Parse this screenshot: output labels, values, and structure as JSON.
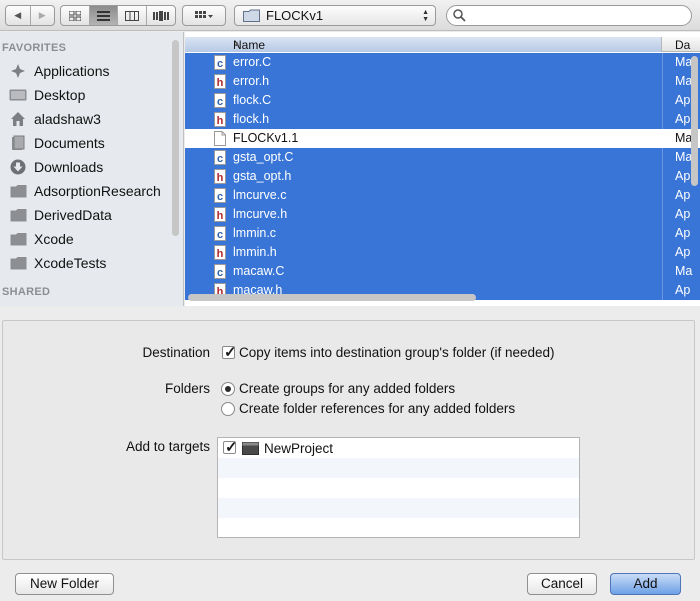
{
  "toolbar": {
    "back_icon": "chevron-left-icon",
    "forward_icon": "chevron-right-icon",
    "view_modes": [
      "icon-view",
      "list-view",
      "column-view",
      "coverflow-view"
    ],
    "active_view": "list-view",
    "arrange_icon": "grid-arrange-icon",
    "location_label": "FLOCKv1",
    "search_placeholder": ""
  },
  "sidebar": {
    "favorites_label": "FAVORITES",
    "items": [
      {
        "label": "Applications",
        "icon": "applications-icon"
      },
      {
        "label": "Desktop",
        "icon": "desktop-icon"
      },
      {
        "label": "aladshaw3",
        "icon": "home-icon"
      },
      {
        "label": "Documents",
        "icon": "documents-icon"
      },
      {
        "label": "Downloads",
        "icon": "downloads-icon"
      },
      {
        "label": "AdsorptionResearch",
        "icon": "folder-icon"
      },
      {
        "label": "DerivedData",
        "icon": "folder-icon"
      },
      {
        "label": "Xcode",
        "icon": "folder-icon"
      },
      {
        "label": "XcodeTests",
        "icon": "folder-icon"
      }
    ],
    "shared_label": "SHARED"
  },
  "filelist": {
    "col_name": "Name",
    "col_date": "Da",
    "files": [
      {
        "name": "error.C",
        "type": "c",
        "date": "Ma",
        "selected": true
      },
      {
        "name": "error.h",
        "type": "h",
        "date": "Ma",
        "selected": true
      },
      {
        "name": "flock.C",
        "type": "c",
        "date": "Ap",
        "selected": true
      },
      {
        "name": "flock.h",
        "type": "h",
        "date": "Ap",
        "selected": true
      },
      {
        "name": "FLOCKv1.1",
        "type": "doc",
        "date": "Ma",
        "selected": false
      },
      {
        "name": "gsta_opt.C",
        "type": "c",
        "date": "Ma",
        "selected": true
      },
      {
        "name": "gsta_opt.h",
        "type": "h",
        "date": "Ap",
        "selected": true
      },
      {
        "name": "lmcurve.c",
        "type": "c",
        "date": "Ap",
        "selected": true
      },
      {
        "name": "lmcurve.h",
        "type": "h",
        "date": "Ap",
        "selected": true
      },
      {
        "name": "lmmin.c",
        "type": "c",
        "date": "Ap",
        "selected": true
      },
      {
        "name": "lmmin.h",
        "type": "h",
        "date": "Ap",
        "selected": true
      },
      {
        "name": "macaw.C",
        "type": "c",
        "date": "Ma",
        "selected": true
      },
      {
        "name": "macaw.h",
        "type": "h",
        "date": "Ap",
        "selected": true
      }
    ]
  },
  "options": {
    "destination_label": "Destination",
    "destination_checked": true,
    "destination_text": "Copy items into destination group's folder (if needed)",
    "folders_label": "Folders",
    "folder_option_1": "Create groups for any added folders",
    "folder_option_2": "Create folder references for any added folders",
    "folder_selected": 1,
    "targets_label": "Add to targets",
    "targets": [
      {
        "name": "NewProject",
        "checked": true,
        "icon": "app-target-icon"
      }
    ]
  },
  "buttons": {
    "new_folder": "New Folder",
    "cancel": "Cancel",
    "add": "Add"
  },
  "colors": {
    "selection": "#3875d7",
    "c_file_badge": "#2f61a8",
    "h_file_badge": "#b0282c"
  }
}
